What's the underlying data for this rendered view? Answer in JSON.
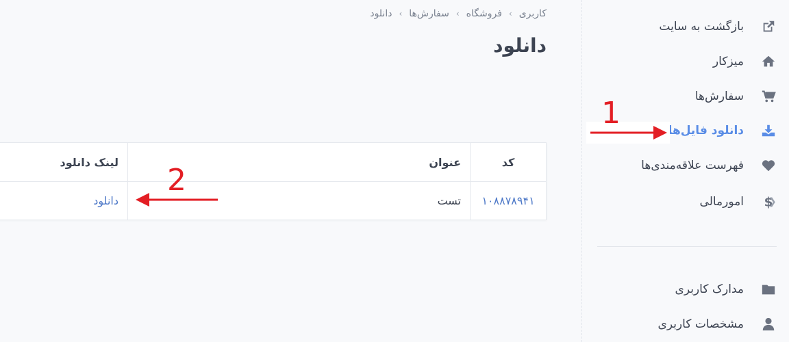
{
  "sidebar": {
    "items": [
      {
        "label": "بازگشت به سایت",
        "icon": "external-link-icon"
      },
      {
        "label": "میزکار",
        "icon": "home-icon"
      },
      {
        "label": "سفارش‌ها",
        "icon": "cart-icon"
      },
      {
        "label": "دانلود فایل‌ها",
        "icon": "download-icon",
        "active": true
      },
      {
        "label": "فهرست علاقه‌مندی‌ها",
        "icon": "heart-icon"
      },
      {
        "label": "امورمالی",
        "icon": "dollar-icon"
      },
      {
        "label": "مدارک کاربری",
        "icon": "folder-icon"
      },
      {
        "label": "مشخصات کاربری",
        "icon": "user-icon"
      }
    ],
    "accent_color": "#5a8de6"
  },
  "breadcrumb": [
    "کاربری",
    "فروشگاه",
    "سفارش‌ها",
    "دانلود"
  ],
  "page_title": "دانلود",
  "table": {
    "headers": {
      "code": "کد",
      "title": "عنوان",
      "link": "لینک دانلود"
    },
    "rows": [
      {
        "code": "۱۰۸۸۷۸۹۴۱",
        "title": "تست",
        "link": "دانلود"
      }
    ]
  },
  "annotations": {
    "one": "1",
    "two": "2",
    "color": "#e31e24"
  }
}
